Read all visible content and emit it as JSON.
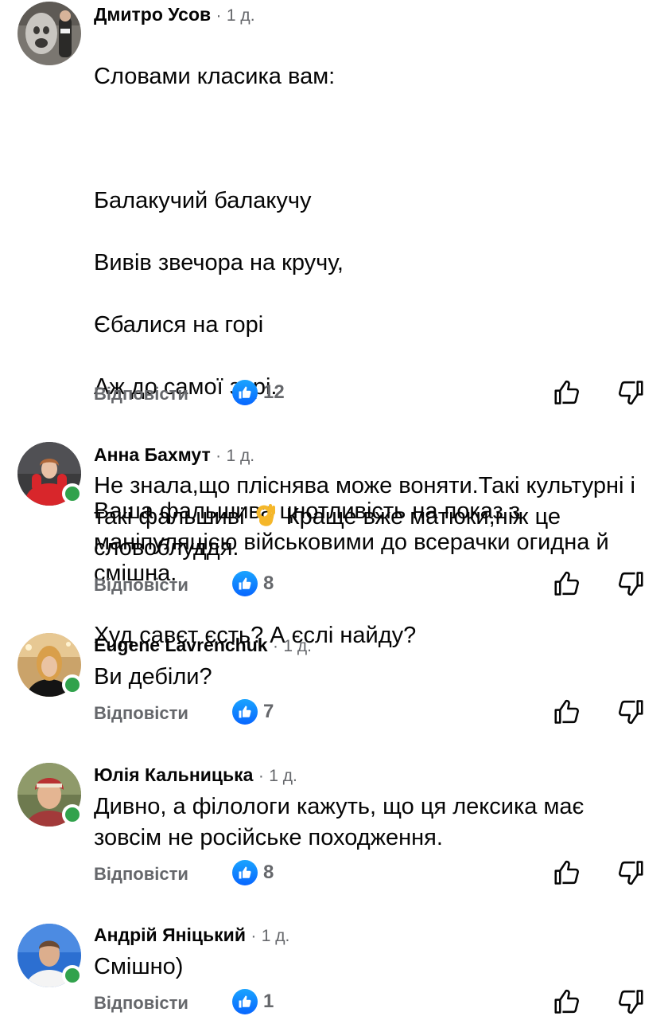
{
  "comments": [
    {
      "author": "Дмитро Усов",
      "separator": "·",
      "time": "1 д.",
      "lines": [
        "Словами класика вам:",
        "",
        "Балакучий балакучу",
        "Вивів звечора на кручу,",
        "Єбалися на горі",
        "Аж до самої зорі.",
        "",
        "Ваша фальшива цнотливість на показ з маніпуляцією військовими до всерачки огидна й смішна.",
        "Худ савєт єсть? А єслі найду?"
      ],
      "reply_label": "Відповісти",
      "likes": "12",
      "online": false
    },
    {
      "author": "Анна Бахмут",
      "separator": "·",
      "time": "1 д.",
      "text_before_emoji": "Не знала,що пліснява може воняти.Такі культурні і такі фальшиві",
      "emoji": "ok-hand-emoji",
      "text_after_emoji": "Краще вже матюки,ніж це словоблуддя.",
      "reply_label": "Відповісти",
      "likes": "8",
      "online": true
    },
    {
      "author": "Eugene Lavrenchuk",
      "separator": "·",
      "time": "1 д.",
      "text": "Ви дебіли?",
      "reply_label": "Відповісти",
      "likes": "7",
      "online": true
    },
    {
      "author": "Юлія Кальницька",
      "separator": "·",
      "time": "1 д.",
      "text": "Дивно, а філологи кажуть, що ця лексика має зовсім не російське походження.",
      "reply_label": "Відповісти",
      "likes": "8",
      "online": true
    },
    {
      "author": "Андрій Яніцький",
      "separator": "·",
      "time": "1 д.",
      "text": "Смішно)",
      "reply_label": "Відповісти",
      "likes": "1",
      "online": true
    }
  ],
  "icons": {
    "like_badge": "thumbs-up-icon",
    "upvote": "thumbs-up-outline-icon",
    "downvote": "thumbs-down-outline-icon"
  },
  "colors": {
    "text": "#050505",
    "secondary": "#65676b",
    "like_blue": "#0866ff",
    "online_green": "#31a24c"
  }
}
